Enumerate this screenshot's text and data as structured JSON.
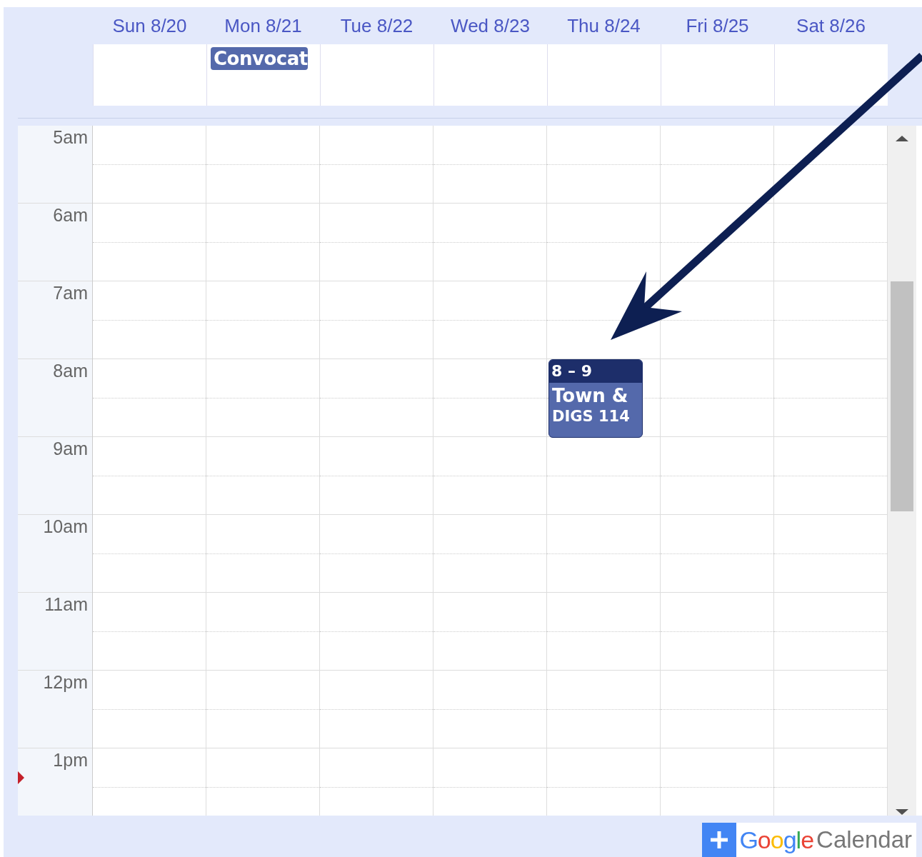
{
  "days": [
    {
      "label": "Sun 8/20"
    },
    {
      "label": "Mon 8/21",
      "all_day_events": [
        {
          "title": "Convocat"
        }
      ]
    },
    {
      "label": "Tue 8/22"
    },
    {
      "label": "Wed 8/23"
    },
    {
      "label": "Thu 8/24"
    },
    {
      "label": "Fri 8/25"
    },
    {
      "label": "Sat 8/26"
    }
  ],
  "hours": [
    {
      "label": "5am"
    },
    {
      "label": "6am"
    },
    {
      "label": "7am"
    },
    {
      "label": "8am",
      "cells": [
        {},
        {},
        {},
        {},
        {
          "events": [
            {
              "time": "8 – 9",
              "title": "Town &",
              "location": "DIGS 114"
            }
          ]
        },
        {},
        {}
      ]
    },
    {
      "label": "9am"
    },
    {
      "label": "10am"
    },
    {
      "label": "11am"
    },
    {
      "label": "12pm"
    },
    {
      "label": "1pm",
      "current_time": true
    }
  ],
  "footer": {
    "brand": "Google",
    "product": "Calendar"
  }
}
